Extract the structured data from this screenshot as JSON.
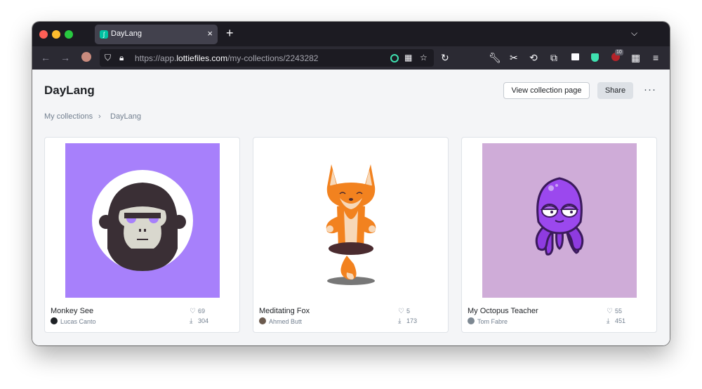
{
  "browser": {
    "tab_title": "DayLang",
    "tab_close": "×",
    "new_tab": "+",
    "url_prefix": "https://app.",
    "url_host": "lottiefiles.com",
    "url_path": "/my-collections/2243282",
    "extension_badge": "10"
  },
  "page": {
    "title": "DayLang",
    "view_button": "View collection page",
    "share_button": "Share",
    "more_button": "···",
    "breadcrumb": [
      "My collections",
      "DayLang"
    ]
  },
  "cards": [
    {
      "name": "Monkey See",
      "author": "Lucas Canto",
      "likes": "69",
      "downloads": "304",
      "bg": "#a780fb"
    },
    {
      "name": "Meditating Fox",
      "author": "Ahmed Butt",
      "likes": "5",
      "downloads": "173",
      "bg": "#ffffff"
    },
    {
      "name": "My Octopus Teacher",
      "author": "Tom Fabre",
      "likes": "55",
      "downloads": "451",
      "bg": "#cfacd8"
    }
  ],
  "icons": {
    "heart": "heart-icon",
    "download": "download-icon"
  }
}
